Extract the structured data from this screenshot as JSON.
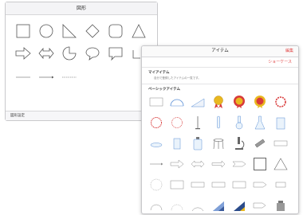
{
  "shapes_panel": {
    "title": "図形",
    "footer_label": "図形設定",
    "shapes": [
      "square-icon",
      "circle-icon",
      "right-triangle-icon",
      "diamond-icon",
      "rounded-square-icon",
      "triangle-icon",
      "arrow-right-icon",
      "double-arrow-icon",
      "pie-icon",
      "speech-bubble-icon",
      "callout-rect-icon",
      "angle-line-icon"
    ],
    "lines": [
      "line-icon",
      "arrow-line-icon",
      "dashed-line-icon"
    ]
  },
  "items_panel": {
    "title": "アイテム",
    "edit_label": "編集",
    "showcase_label": "ショーケース",
    "my_items": {
      "title": "マイアイテム",
      "description": "自分で登録したアイテムの一覧です。"
    },
    "basic_items": {
      "title": "ベーシックアイテム"
    },
    "colors": {
      "accent": "#e24a4a",
      "medal_gold": "#e9b820",
      "ribbon_red": "#d83a3a",
      "diagram_blue": "#5a8fd6"
    }
  }
}
